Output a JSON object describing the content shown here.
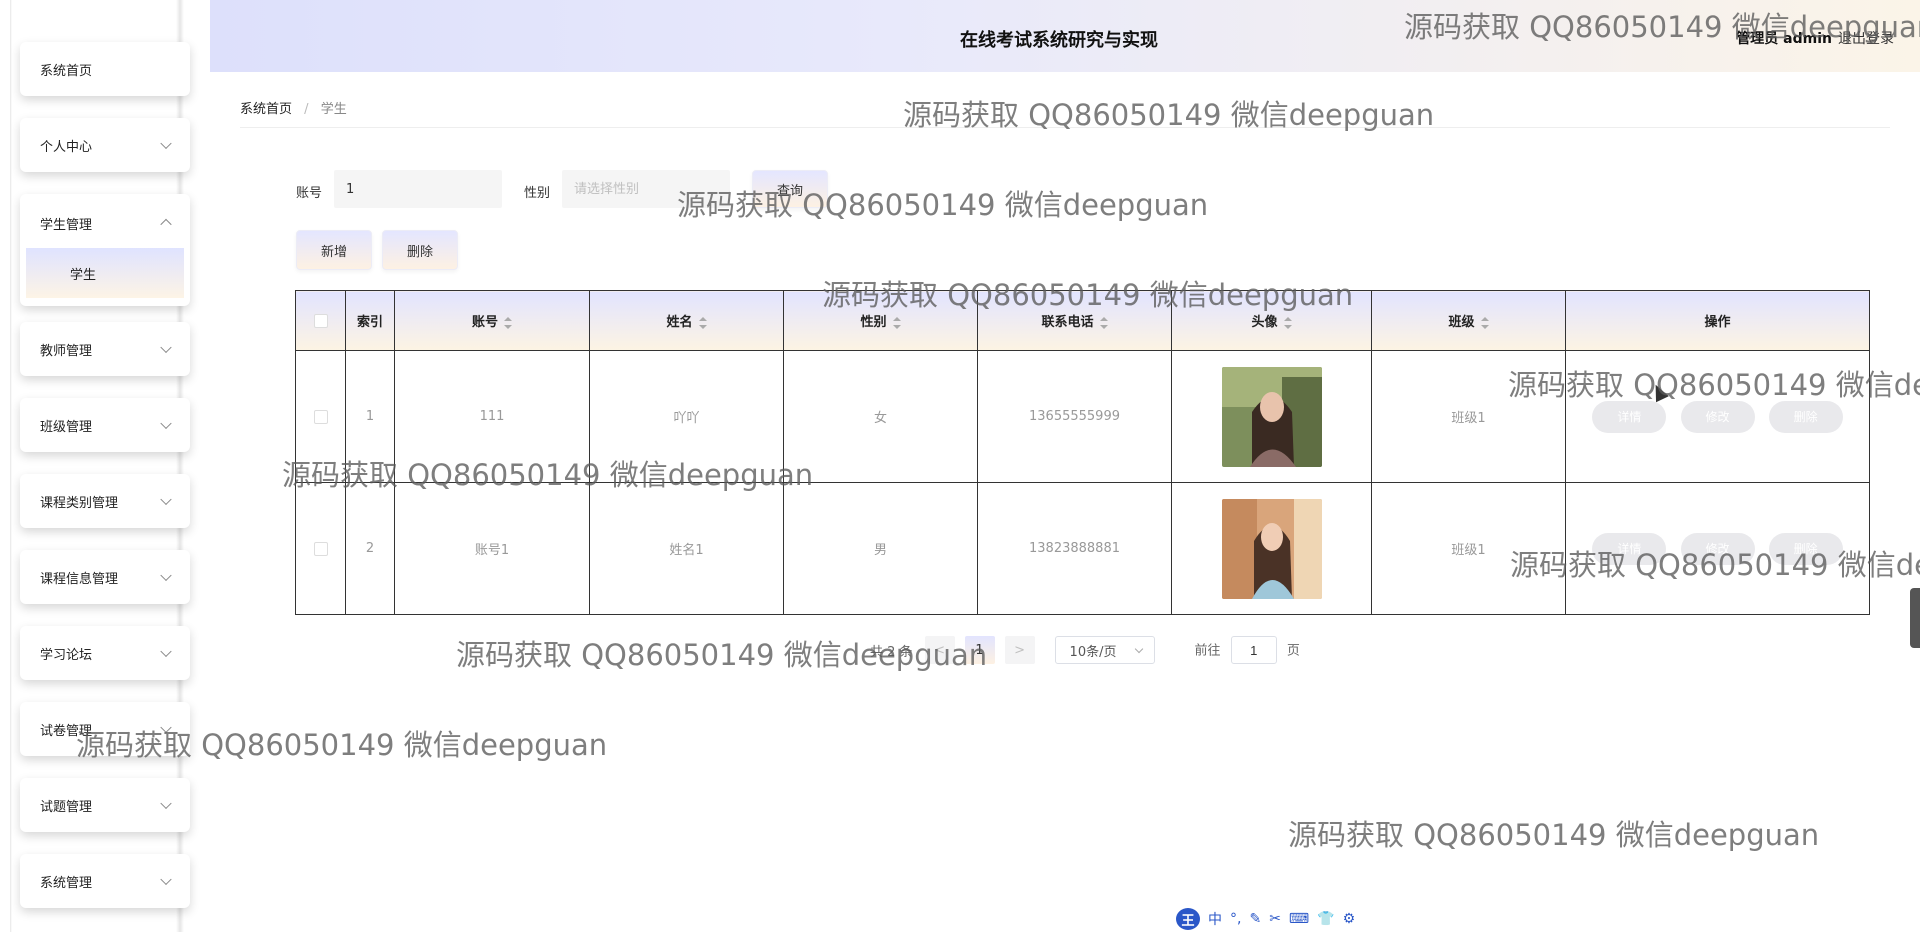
{
  "header": {
    "title": "在线考试系统研究与实现",
    "user": "管理员 admin",
    "logout": "退出登录"
  },
  "sidebar": {
    "items": [
      {
        "label": "系统首页"
      },
      {
        "label": "个人中心"
      },
      {
        "label": "学生管理",
        "sub": "学生"
      },
      {
        "label": "教师管理"
      },
      {
        "label": "班级管理"
      },
      {
        "label": "课程类别管理"
      },
      {
        "label": "课程信息管理"
      },
      {
        "label": "学习论坛"
      },
      {
        "label": "试卷管理"
      },
      {
        "label": "试题管理"
      },
      {
        "label": "系统管理"
      }
    ]
  },
  "breadcrumb": {
    "home": "系统首页",
    "separator": "/",
    "current": "学生"
  },
  "search": {
    "account_label": "账号",
    "account_value": "1",
    "gender_label": "性别",
    "gender_placeholder": "请选择性别",
    "query_button": "查询"
  },
  "actions": {
    "add": "新增",
    "delete": "删除"
  },
  "table": {
    "headers": {
      "index": "索引",
      "account": "账号",
      "name": "姓名",
      "gender": "性别",
      "phone": "联系电话",
      "avatar": "头像",
      "class": "班级",
      "ops": "操作"
    },
    "rows": [
      {
        "index": "1",
        "account": "111",
        "name": "吖吖",
        "gender": "女",
        "phone": "13655555999",
        "class": "班级1"
      },
      {
        "index": "2",
        "account": "账号1",
        "name": "姓名1",
        "gender": "男",
        "phone": "13823888881",
        "class": "班级1"
      }
    ],
    "op_labels": {
      "detail": "详情",
      "edit": "修改",
      "delete": "删除"
    }
  },
  "pagination": {
    "total": "共 2 条",
    "prev": "<",
    "current_page": "1",
    "next": ">",
    "page_size": "10条/页",
    "goto_label": "前往",
    "goto_value": "1",
    "page_suffix": "页"
  },
  "watermark": "源码获取 QQ86050149 微信deepguan",
  "ime_toolbar": {
    "logo": "王",
    "mode": "中",
    "glyphs": [
      "°,",
      "✎",
      "✂",
      "⌨",
      "👕",
      "⚙"
    ]
  },
  "colors": {
    "header_gradient_start": "#dde0fb",
    "header_gradient_end": "#fbf4e8",
    "button_gradient_start": "#e4e6ff",
    "button_gradient_end": "#fdf1e3"
  }
}
